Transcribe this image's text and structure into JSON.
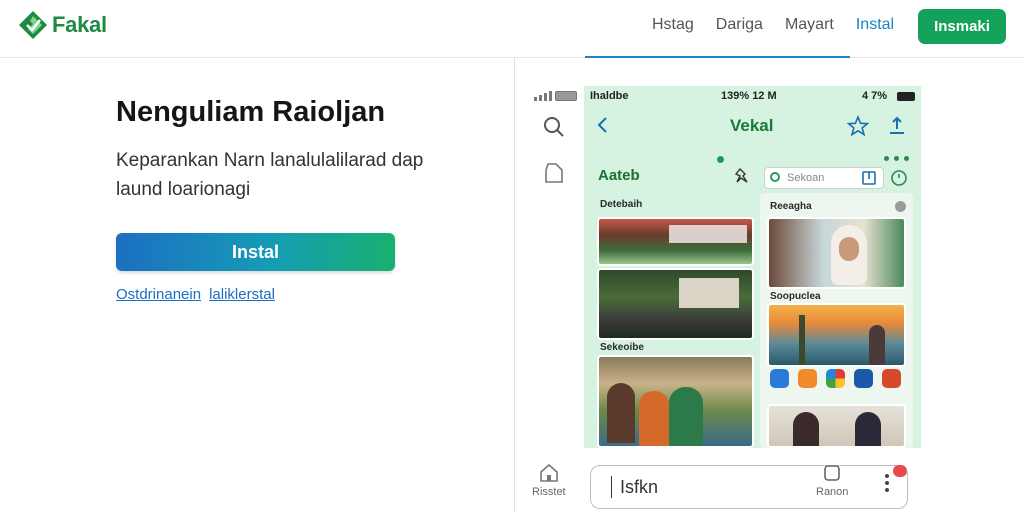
{
  "header": {
    "logo_text": "Fakal",
    "nav": [
      {
        "label": "Hstag",
        "active": false
      },
      {
        "label": "Dariga",
        "active": false
      },
      {
        "label": "Mayart",
        "active": false
      },
      {
        "label": "Instal",
        "active": true
      }
    ],
    "cta_label": "Insmaki"
  },
  "hero": {
    "title": "Nenguliam Raioljan",
    "description": "Keparankan Narn lanalulalilarad dap laund loarionagi",
    "install_button": "Instal",
    "links": [
      "Ostdrinanein",
      "laliklerstal"
    ]
  },
  "sidebar": {
    "bottom_label_left": "Risstet",
    "bottom_label_right": "Ranon",
    "search_value": "Isfkn"
  },
  "phone": {
    "status_left": "Ihaldbe",
    "status_center": "139% 12 M",
    "status_right": "4 7%",
    "app_title": "Vekal",
    "section_title": "Aateb",
    "search_placeholder": "Sekoan",
    "col_left_label_1": "Detebaih",
    "col_left_label_2": "Sekeoibe",
    "col_right_label_1": "Reeagha",
    "col_right_label_2": "Soopuclea"
  },
  "colors": {
    "brand_green": "#14a15a",
    "link_blue": "#1c6fc2",
    "phone_bg": "#d6f2e0"
  },
  "icons": [
    "logo-mark-icon",
    "search-icon",
    "home-icon",
    "back-chevron-icon",
    "star-icon",
    "share-icon",
    "pin-icon",
    "bookmark-icon",
    "timer-icon",
    "more-vert-icon"
  ]
}
